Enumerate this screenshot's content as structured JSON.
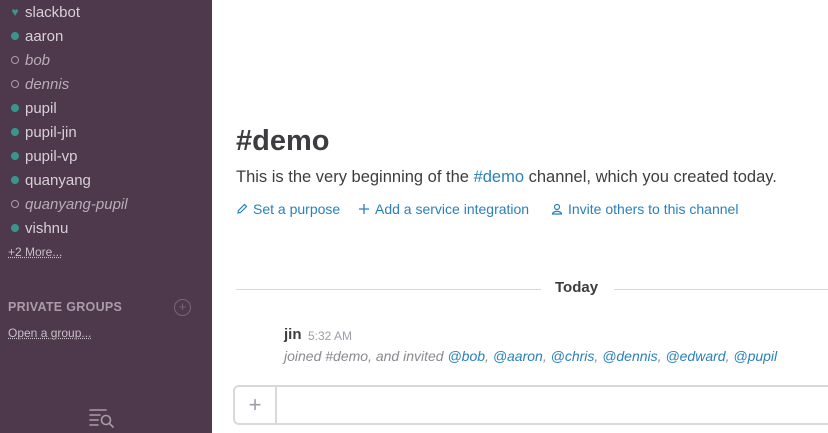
{
  "sidebar": {
    "direct_messages": [
      {
        "name": "slackbot",
        "status": "bot",
        "italic": false
      },
      {
        "name": "aaron",
        "status": "online",
        "italic": false
      },
      {
        "name": "bob",
        "status": "offline",
        "italic": true
      },
      {
        "name": "dennis",
        "status": "offline",
        "italic": true
      },
      {
        "name": "pupil",
        "status": "online",
        "italic": false
      },
      {
        "name": "pupil-jin",
        "status": "online",
        "italic": false
      },
      {
        "name": "pupil-vp",
        "status": "online",
        "italic": false
      },
      {
        "name": "quanyang",
        "status": "online",
        "italic": false
      },
      {
        "name": "quanyang-pupil",
        "status": "offline",
        "italic": true
      },
      {
        "name": "vishnu",
        "status": "online",
        "italic": false
      }
    ],
    "more_link": "+2 More...",
    "private_groups_title": "PRIVATE GROUPS",
    "open_group_link": "Open a group...",
    "colors": {
      "background": "#4d394b",
      "presence": "#38978d"
    },
    "icons": {
      "add_group": "plus-circle-icon",
      "quick_switcher": "list-search-icon"
    }
  },
  "channel": {
    "title": "#demo",
    "intro_before": "This is the very beginning of the ",
    "intro_link": "#demo",
    "intro_after": " channel, which you created today.",
    "actions": {
      "purpose": "Set a purpose",
      "integration": "Add a service integration",
      "invite": "Invite others to this channel"
    }
  },
  "messages": {
    "day_divider": "Today",
    "items": [
      {
        "author": "jin",
        "time": "5:32 AM",
        "text_prefix": "joined #demo, and invited ",
        "mentions": [
          "@bob",
          "@aaron",
          "@chris",
          "@dennis",
          "@edward",
          "@pupil"
        ]
      }
    ]
  },
  "composer": {
    "plus_label": "+",
    "placeholder": ""
  },
  "accent_color": "#2a80b9"
}
